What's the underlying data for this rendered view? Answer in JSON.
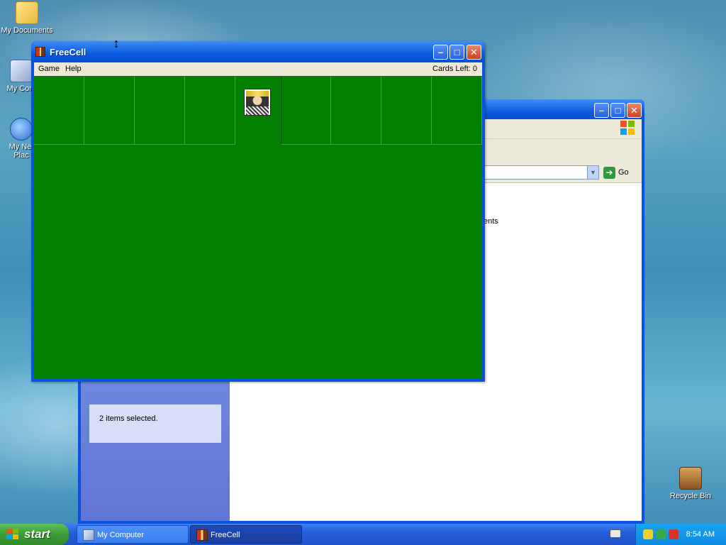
{
  "desktop": {
    "icons": [
      {
        "label": "My Documents",
        "icon": "my-documents-icon"
      },
      {
        "label": "My Com",
        "icon": "my-computer-icon"
      },
      {
        "label": "My Net",
        "label2": "Plac",
        "icon": "network-places-icon"
      },
      {
        "label": "Recycle Bin",
        "icon": "recycle-bin-icon"
      }
    ]
  },
  "explorer": {
    "go_label": "Go",
    "status_text": "2 items selected.",
    "partial_text": "ents"
  },
  "freecell": {
    "title": "FreeCell",
    "menu": [
      "Game",
      "Help"
    ],
    "cards_left": "Cards Left: 0",
    "center_card": "king-card"
  },
  "taskbar": {
    "start_label": "start",
    "tasks": [
      {
        "label": "My Computer",
        "state": "inactive"
      },
      {
        "label": "FreeCell",
        "state": "active"
      }
    ],
    "clock": "8:54 AM"
  },
  "colors": {
    "felt": "#007f00",
    "titlebar": "#0a5be0",
    "start_green": "#3c9c36"
  }
}
